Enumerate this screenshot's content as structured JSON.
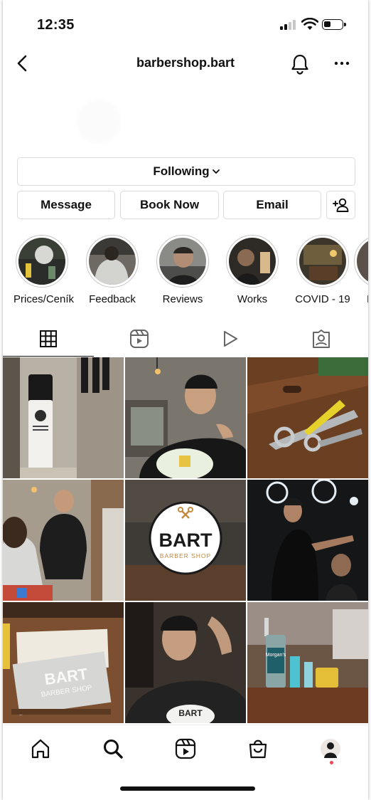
{
  "status_bar": {
    "time": "12:35"
  },
  "header": {
    "username": "barbershop.bart"
  },
  "actions": {
    "following_label": "Following",
    "message_label": "Message",
    "book_label": "Book Now",
    "email_label": "Email"
  },
  "highlights": [
    {
      "label": "Prices/Ceník"
    },
    {
      "label": "Feedback"
    },
    {
      "label": "Reviews"
    },
    {
      "label": "Works"
    },
    {
      "label": "COVID - 19"
    },
    {
      "label": "B"
    }
  ],
  "tabs": [
    {
      "icon": "grid-icon",
      "active": true
    },
    {
      "icon": "reels-icon",
      "active": false
    },
    {
      "icon": "video-play-icon",
      "active": false
    },
    {
      "icon": "tagged-icon",
      "active": false
    }
  ],
  "posts": {
    "logo_post": {
      "brand": "BART",
      "subtitle": "BARBER SHOP"
    },
    "card_post": {
      "brand": "BART",
      "subtitle": "BARBER SHOP"
    },
    "cape_post": {
      "brand": "BART"
    },
    "product_post": {
      "brand": "Morgan's"
    }
  },
  "bottom_nav": [
    {
      "icon": "home-icon"
    },
    {
      "icon": "search-icon"
    },
    {
      "icon": "reels-icon"
    },
    {
      "icon": "shop-icon"
    },
    {
      "icon": "profile-avatar"
    }
  ],
  "colors": {
    "notification_dot": "#ed4956",
    "border": "#dbdbdb"
  }
}
